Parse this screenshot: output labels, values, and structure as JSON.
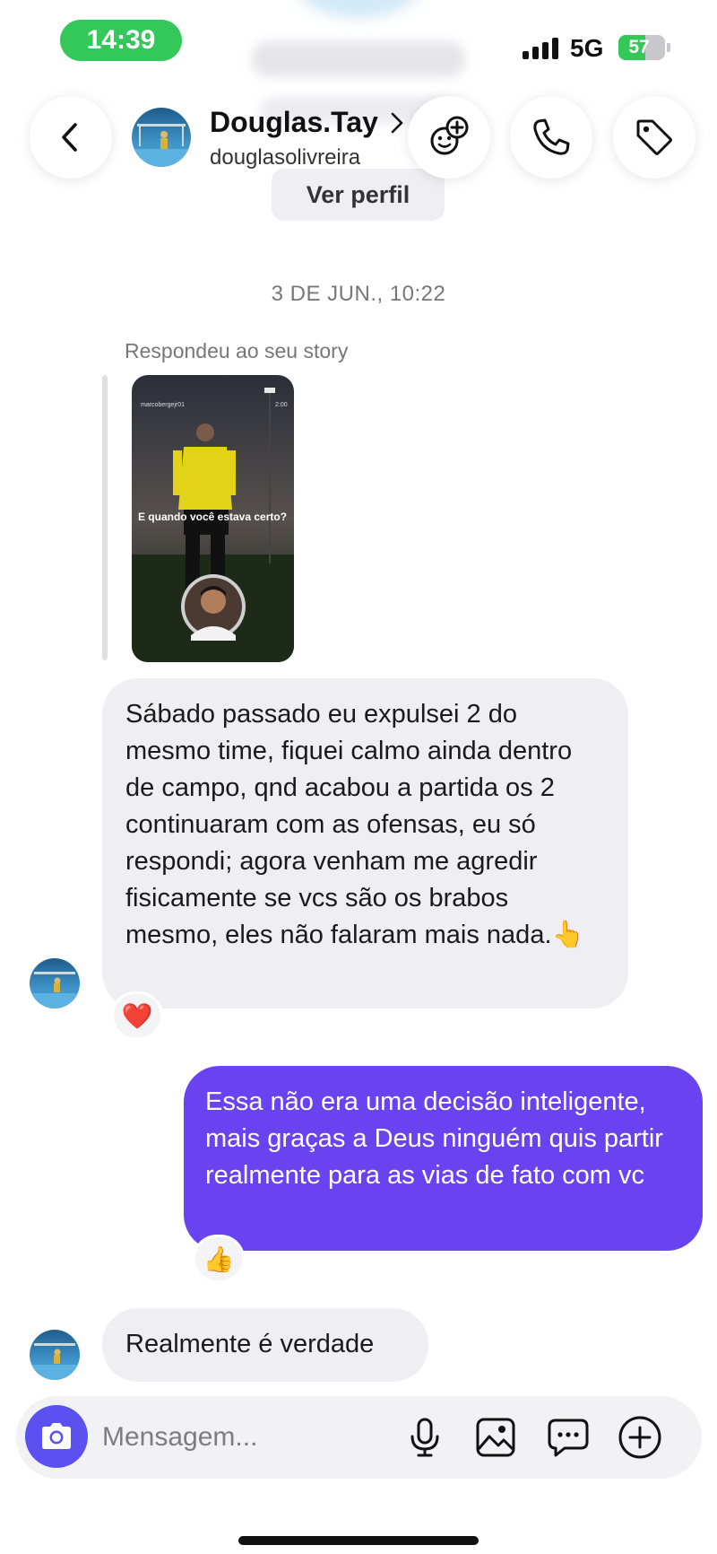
{
  "status_bar": {
    "time": "14:39",
    "network": "5G",
    "battery": "57",
    "battery_level": 0.57
  },
  "header": {
    "name": "Douglas.Tay",
    "username": "douglasolivreira",
    "view_profile": "Ver perfil",
    "chevron": "›"
  },
  "conversation": {
    "date_divider": "3 DE JUN., 10:22",
    "reply_caption": "Respondeu ao seu story",
    "story": {
      "account": "marcobergejr01",
      "duration": "2:00",
      "caption": "E quando você estava certo?"
    },
    "messages": [
      {
        "sender": "them",
        "text": "Sábado passado eu expulsei 2 do mesmo time, fiquei calmo ainda dentro de campo, qnd acabou a partida os 2 continuaram com as ofensas, eu só respondi; agora venham me agredir fisicamente se vcs são os brabos mesmo, eles não falaram mais nada.👆",
        "reaction": "❤️"
      },
      {
        "sender": "me",
        "text": "Essa não era uma decisão inteligente, mais graças a Deus ninguém quis partir realmente para as vias de fato com vc",
        "reaction": "👍"
      },
      {
        "sender": "them",
        "text": "Realmente é verdade"
      }
    ]
  },
  "composer": {
    "placeholder": "Mensagem..."
  },
  "colors": {
    "outgoing": "#6a43f0",
    "incoming": "#efeff3",
    "camera": "#5b51f0",
    "time_pill": "#34c759"
  },
  "icons": [
    "back-arrow-icon",
    "add-people-icon",
    "phone-icon",
    "tag-icon",
    "camera-icon",
    "microphone-icon",
    "gallery-icon",
    "chat-icon",
    "plus-circle-icon"
  ]
}
